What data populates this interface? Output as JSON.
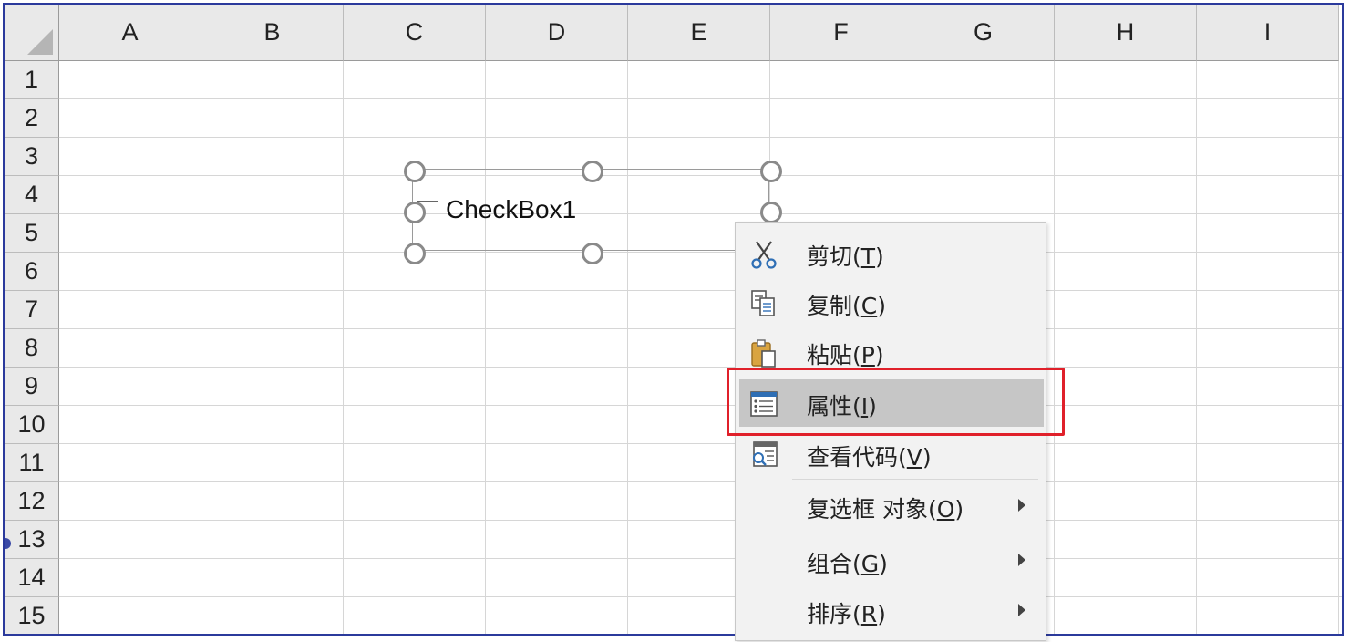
{
  "columns": [
    "A",
    "B",
    "C",
    "D",
    "E",
    "F",
    "G",
    "H",
    "I"
  ],
  "rows": [
    "1",
    "2",
    "3",
    "4",
    "5",
    "6",
    "7",
    "8",
    "9",
    "10",
    "11",
    "12",
    "13",
    "14",
    "15"
  ],
  "checkbox": {
    "label": "CheckBox1"
  },
  "context_menu": {
    "items": [
      {
        "text": "剪切(",
        "key": "T",
        "close": ")",
        "icon": "scissors-icon"
      },
      {
        "text": "复制(",
        "key": "C",
        "close": ")",
        "icon": "copy-icon"
      },
      {
        "text": "粘贴(",
        "key": "P",
        "close": ")",
        "icon": "paste-icon"
      },
      {
        "text": "属性(",
        "key": "I",
        "close": ")",
        "icon": "properties-icon",
        "highlighted": true
      },
      {
        "text": "查看代码(",
        "key": "V",
        "close": ")",
        "icon": "view-code-icon"
      },
      {
        "text": "复选框 对象(",
        "key": "O",
        "close": ")",
        "submenu": true
      },
      {
        "text": "组合(",
        "key": "G",
        "close": ")",
        "submenu": true
      },
      {
        "text": "排序(",
        "key": "R",
        "close": ")",
        "submenu": true
      }
    ]
  },
  "colors": {
    "highlight_outline": "#e0202a",
    "menu_highlight": "#c6c6c6",
    "frame": "#2b3a9c"
  }
}
